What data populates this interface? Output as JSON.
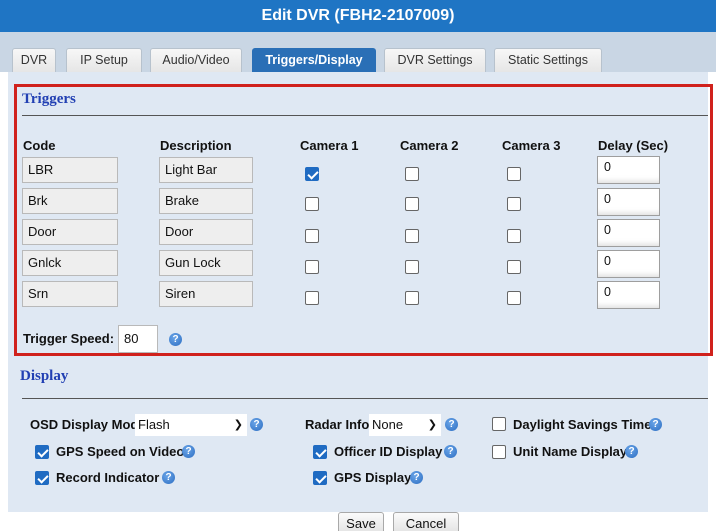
{
  "window": {
    "title": "Edit DVR (FBH2-2107009)"
  },
  "tabs": [
    {
      "label": "DVR"
    },
    {
      "label": "IP Setup"
    },
    {
      "label": "Audio/Video"
    },
    {
      "label": "Triggers/Display",
      "active": true
    },
    {
      "label": "DVR Settings"
    },
    {
      "label": "Static Settings"
    }
  ],
  "triggers": {
    "title": "Triggers",
    "headers": {
      "code": "Code",
      "description": "Description",
      "cam1": "Camera 1",
      "cam2": "Camera 2",
      "cam3": "Camera 3",
      "delay": "Delay (Sec)"
    },
    "rows": [
      {
        "code": "LBR",
        "description": "Light Bar",
        "cam1": true,
        "cam2": false,
        "cam3": false,
        "delay": "0"
      },
      {
        "code": "Brk",
        "description": "Brake",
        "cam1": false,
        "cam2": false,
        "cam3": false,
        "delay": "0"
      },
      {
        "code": "Door",
        "description": "Door",
        "cam1": false,
        "cam2": false,
        "cam3": false,
        "delay": "0"
      },
      {
        "code": "Gnlck",
        "description": "Gun Lock",
        "cam1": false,
        "cam2": false,
        "cam3": false,
        "delay": "0"
      },
      {
        "code": "Srn",
        "description": "Siren",
        "cam1": false,
        "cam2": false,
        "cam3": false,
        "delay": "0"
      }
    ],
    "speed_label": "Trigger Speed:",
    "speed_value": "80"
  },
  "display": {
    "title": "Display",
    "osd_label": "OSD Display Mode",
    "osd_value": "Flash",
    "radar_label": "Radar Info:",
    "radar_value": "None",
    "daylight_label": "Daylight Savings Time",
    "daylight_checked": false,
    "gps_speed_label": "GPS Speed on Video",
    "gps_speed_checked": true,
    "officer_id_label": "Officer ID Display",
    "officer_id_checked": true,
    "unit_name_label": "Unit Name Display",
    "unit_name_checked": false,
    "record_indicator_label": "Record Indicator",
    "record_indicator_checked": true,
    "gps_display_label": "GPS Display",
    "gps_display_checked": true
  },
  "buttons": {
    "save": "Save",
    "cancel": "Cancel"
  },
  "colors": {
    "title_bar": "#1f75c4",
    "active_tab": "#2a6fb6",
    "panel_bg": "#dfe8f3",
    "highlight_box": "#d0211c",
    "section_title": "#2240b3",
    "checkbox_checked": "#1f6bc2"
  }
}
